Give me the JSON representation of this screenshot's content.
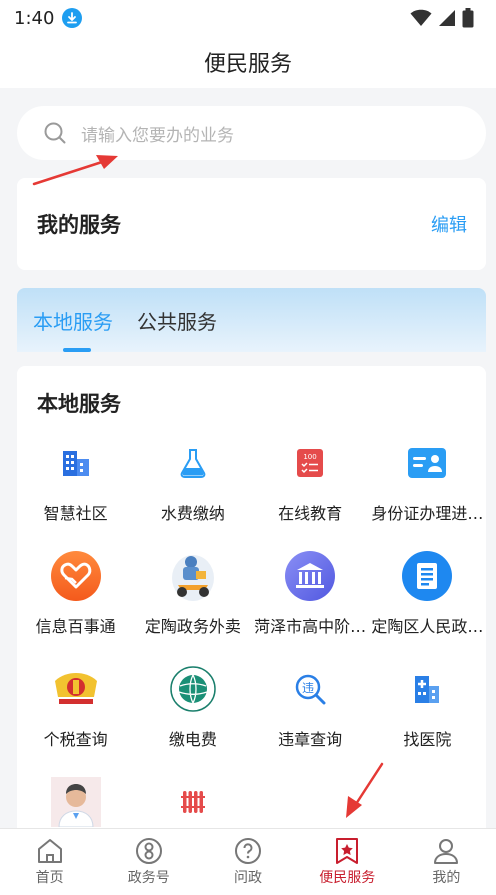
{
  "status_bar": {
    "time": "1:40"
  },
  "header": {
    "title": "便民服务"
  },
  "search": {
    "placeholder": "请输入您要办的业务"
  },
  "my_service": {
    "title": "我的服务",
    "edit_label": "编辑"
  },
  "tabs": [
    {
      "label": "本地服务",
      "active": true
    },
    {
      "label": "公共服务",
      "active": false
    }
  ],
  "local_services": {
    "title": "本地服务",
    "items": [
      {
        "label": "智慧社区",
        "icon": "building-icon"
      },
      {
        "label": "水费缴纳",
        "icon": "flask-icon"
      },
      {
        "label": "在线教育",
        "icon": "checklist-icon"
      },
      {
        "label": "身份证办理进…",
        "icon": "id-card-icon"
      },
      {
        "label": "信息百事通",
        "icon": "heart-hand-icon"
      },
      {
        "label": "定陶政务外卖",
        "icon": "delivery-rider-icon"
      },
      {
        "label": "菏泽市高中阶…",
        "icon": "school-building-icon"
      },
      {
        "label": "定陶区人民政…",
        "icon": "document-icon"
      },
      {
        "label": "个税查询",
        "icon": "tax-emblem-icon"
      },
      {
        "label": "缴电费",
        "icon": "state-grid-icon"
      },
      {
        "label": "违章查询",
        "icon": "violation-search-icon"
      },
      {
        "label": "找医院",
        "icon": "hospital-icon"
      },
      {
        "label": "",
        "icon": "doctor-icon"
      },
      {
        "label": "",
        "icon": "radiator-icon"
      }
    ]
  },
  "bottom_nav": [
    {
      "label": "首页",
      "icon": "home-icon",
      "active": false
    },
    {
      "label": "政务号",
      "icon": "gov-account-icon",
      "active": false
    },
    {
      "label": "问政",
      "icon": "question-icon",
      "active": false
    },
    {
      "label": "便民服务",
      "icon": "star-bookmark-icon",
      "active": true
    },
    {
      "label": "我的",
      "icon": "user-icon",
      "active": false
    }
  ],
  "colors": {
    "accent": "#2a9df4",
    "nav_active": "#c81e2e",
    "annotation_arrow": "#e53935"
  }
}
